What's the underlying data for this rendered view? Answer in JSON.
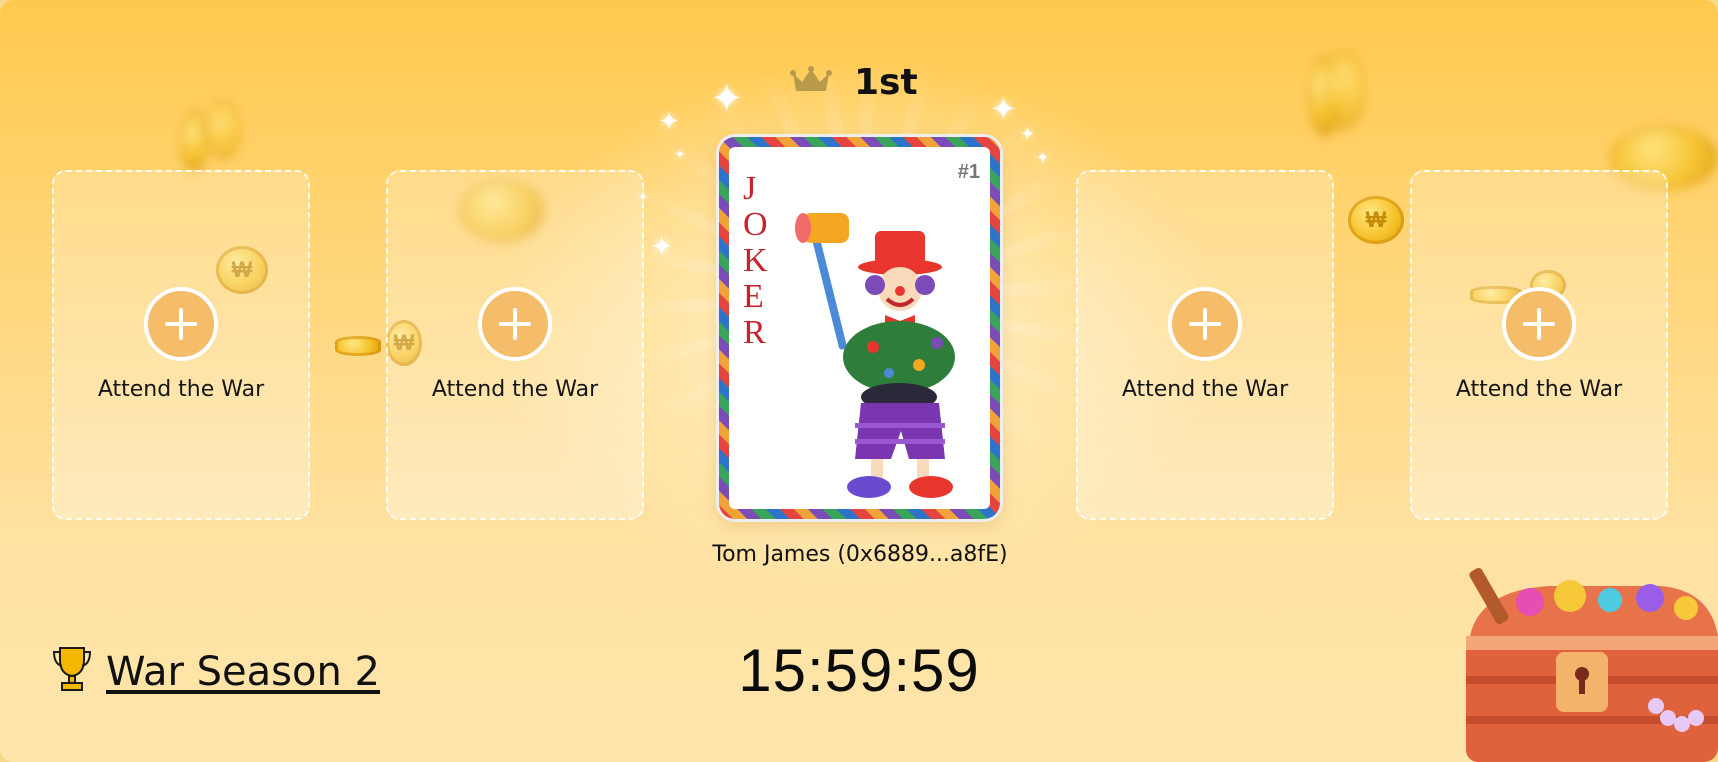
{
  "rank": {
    "label": "1st",
    "icon": "crown-icon"
  },
  "slots": [
    {
      "label": "Attend the War",
      "icon": "plus-icon"
    },
    {
      "label": "Attend the War",
      "icon": "plus-icon"
    },
    {
      "label": "Attend the War",
      "icon": "plus-icon"
    },
    {
      "label": "Attend the War",
      "icon": "plus-icon"
    }
  ],
  "main_card": {
    "title": "JOKER",
    "letters": [
      "J",
      "O",
      "K",
      "E",
      "R"
    ],
    "number": "#1",
    "player": "Tom James (0x6889...a8fE)"
  },
  "season": {
    "title": "War Season 2",
    "icon": "trophy-icon"
  },
  "timer": "15:59:59",
  "colors": {
    "background_top": "#ffc94e",
    "background_bottom": "#ffe6ad",
    "plus_button": "#f5bc6a",
    "joker_red": "#c7232c",
    "crown": "#b89b4a"
  }
}
